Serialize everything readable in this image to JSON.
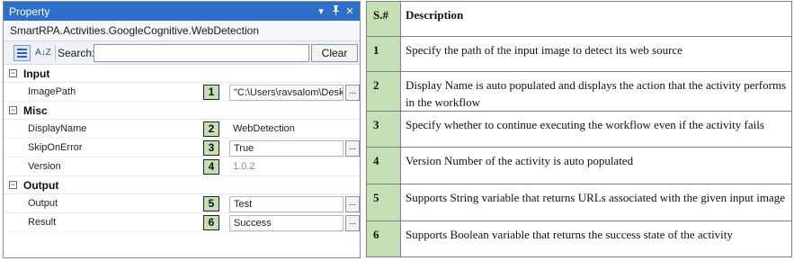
{
  "panel": {
    "title": "Property",
    "title_icons": [
      "▾",
      "ᵖ",
      "✕"
    ],
    "activity_name": "SmartRPA.Activities.GoogleCognitive.WebDetection",
    "toolbar": {
      "search_label": "Search:",
      "search_value": "",
      "clear_label": "Clear",
      "sort_alpha_label": "A↓Z"
    },
    "categories": [
      {
        "label": "Input",
        "collapse_symbol": "−",
        "properties": [
          {
            "name": "ImagePath",
            "badge": "1",
            "value": "\"C:\\Users\\ravsalom\\Desk",
            "has_button": true,
            "style": "box"
          }
        ]
      },
      {
        "label": "Misc",
        "collapse_symbol": "−",
        "properties": [
          {
            "name": "DisplayName",
            "badge": "2",
            "value": "WebDetection",
            "has_button": false,
            "style": "plain"
          },
          {
            "name": "SkipOnError",
            "badge": "3",
            "value": "True",
            "has_button": true,
            "style": "box"
          },
          {
            "name": "Version",
            "badge": "4",
            "value": "1.0.2",
            "has_button": false,
            "style": "grey"
          }
        ]
      },
      {
        "label": "Output",
        "collapse_symbol": "−",
        "properties": [
          {
            "name": "Output",
            "badge": "5",
            "value": "Test",
            "has_button": true,
            "style": "box"
          },
          {
            "name": "Result",
            "badge": "6",
            "value": "Success",
            "has_button": true,
            "style": "box"
          }
        ]
      }
    ],
    "button_label": "..."
  },
  "table": {
    "headers": {
      "num": "S.#",
      "description": "Description"
    },
    "rows": [
      {
        "num": "1",
        "description": "Specify the path of the input image to detect its web source"
      },
      {
        "num": "2",
        "description": "Display Name is auto populated and displays the action that the activity performs in the workflow"
      },
      {
        "num": "3",
        "description": "Specify whether to continue executing the workflow even if the activity fails"
      },
      {
        "num": "4",
        "description": "Version Number of the activity is auto populated"
      },
      {
        "num": "5",
        "description": "Supports String variable that returns URLs associated with  the given input image"
      },
      {
        "num": "6",
        "description": "Supports Boolean variable that returns the success state of the activity"
      }
    ]
  },
  "colors": {
    "title_bar": "#2d6fc9",
    "badge_fill": "#c5e0b4",
    "num_column_fill": "#c5e0b4"
  }
}
